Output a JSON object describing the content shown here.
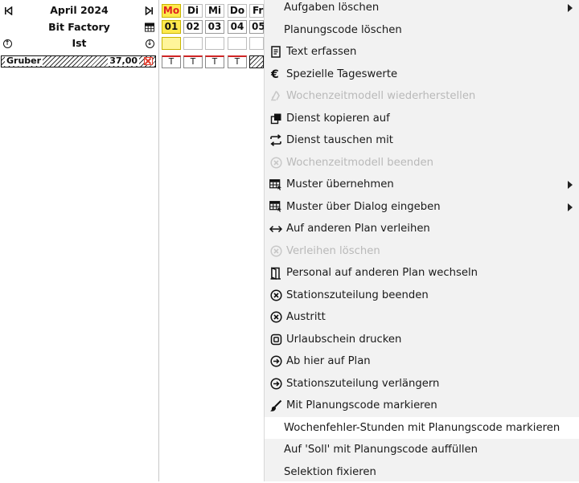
{
  "plan": {
    "month": "April 2024",
    "department": "Bit Factory",
    "mode": "Ist"
  },
  "employee": {
    "name": "Gruber",
    "hours": "37,00"
  },
  "days": [
    {
      "weekday": "Mo",
      "date": "01"
    },
    {
      "weekday": "Di",
      "date": "02"
    },
    {
      "weekday": "Mi",
      "date": "03"
    },
    {
      "weekday": "Do",
      "date": "04"
    },
    {
      "weekday": "Fr",
      "date": "05"
    }
  ],
  "shift_codes": [
    "T",
    "T",
    "T",
    "T"
  ],
  "menu": {
    "items": [
      {
        "label": "Aufgaben löschen",
        "icon": "none",
        "disabled": false,
        "submenu": true
      },
      {
        "label": "Planungscode löschen",
        "icon": "none",
        "disabled": false,
        "submenu": false
      },
      {
        "label": "Text erfassen",
        "icon": "document-icon",
        "disabled": false,
        "submenu": false
      },
      {
        "label": "Spezielle Tageswerte",
        "icon": "euro-icon",
        "disabled": false,
        "submenu": false
      },
      {
        "label": "Wochenzeitmodell wiederherstellen",
        "icon": "recycle-icon",
        "disabled": true,
        "submenu": false
      },
      {
        "label": "Dienst kopieren auf",
        "icon": "copy-icon",
        "disabled": false,
        "submenu": false
      },
      {
        "label": "Dienst tauschen mit",
        "icon": "swap-icon",
        "disabled": false,
        "submenu": false
      },
      {
        "label": "Wochenzeitmodell beenden",
        "icon": "circle-x-icon",
        "disabled": true,
        "submenu": false
      },
      {
        "label": "Muster übernehmen",
        "icon": "pattern-icon",
        "disabled": false,
        "submenu": true
      },
      {
        "label": "Muster über Dialog eingeben",
        "icon": "pattern-icon",
        "disabled": false,
        "submenu": true
      },
      {
        "label": "Auf anderen Plan verleihen",
        "icon": "double-arrow-icon",
        "disabled": false,
        "submenu": false
      },
      {
        "label": "Verleihen löschen",
        "icon": "circle-x-icon",
        "disabled": true,
        "submenu": false
      },
      {
        "label": "Personal auf anderen Plan wechseln",
        "icon": "door-icon",
        "disabled": false,
        "submenu": false
      },
      {
        "label": "Stationszuteilung beenden",
        "icon": "circle-x-icon",
        "disabled": false,
        "submenu": false
      },
      {
        "label": "Austritt",
        "icon": "circle-x-icon",
        "disabled": false,
        "submenu": false
      },
      {
        "label": "Urlaubschein drucken",
        "icon": "print-icon",
        "disabled": false,
        "submenu": false
      },
      {
        "label": "Ab hier auf Plan",
        "icon": "circle-arrow-icon",
        "disabled": false,
        "submenu": false
      },
      {
        "label": "Stationszuteilung verlängern",
        "icon": "circle-arrow-icon",
        "disabled": false,
        "submenu": false
      },
      {
        "label": "Mit Planungscode markieren",
        "icon": "brush-icon",
        "disabled": false,
        "submenu": false
      },
      {
        "label": "Wochenfehler-Stunden mit Planungscode markieren",
        "icon": "none",
        "disabled": false,
        "submenu": false,
        "highlighted": true
      },
      {
        "label": "Auf 'Soll' mit Planungscode auffüllen",
        "icon": "none",
        "disabled": false,
        "submenu": false
      },
      {
        "label": "Selektion fixieren",
        "icon": "none",
        "disabled": false,
        "submenu": false
      }
    ]
  },
  "colors": {
    "today_bg": "#ffe94d",
    "today_text": "#e02020",
    "menu_bg": "#f2f2f2",
    "disabled_text": "#b9b9b9",
    "shift_marker": "#d02424"
  }
}
